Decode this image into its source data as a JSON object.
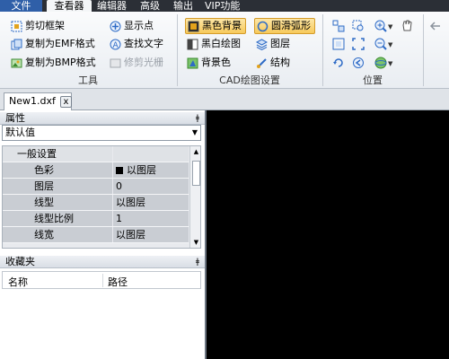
{
  "menu": {
    "file": "文件",
    "tabs": [
      "查看器",
      "编辑器",
      "高级",
      "输出",
      "VIP功能"
    ]
  },
  "ribbon": {
    "tools": {
      "label": "工具",
      "buttons": [
        "剪切框架",
        "复制为EMF格式",
        "复制为BMP格式",
        "显示点",
        "查找文字",
        "修剪光栅"
      ]
    },
    "cad": {
      "label": "CAD绘图设置",
      "buttons": [
        "黑色背景",
        "黑白绘图",
        "背景色",
        "圆滑弧形",
        "图层",
        "结构"
      ]
    },
    "position": {
      "label": "位置"
    }
  },
  "doc_tab": {
    "name": "New1.dxf",
    "close": "x"
  },
  "properties": {
    "title": "属性",
    "pin": "ǂ",
    "dropdown_value": "默认值",
    "group": "一般设置",
    "rows": [
      {
        "label": "色彩",
        "value": "以图层"
      },
      {
        "label": "图层",
        "value": "0"
      },
      {
        "label": "线型",
        "value": "以图层"
      },
      {
        "label": "线型比例",
        "value": "1"
      },
      {
        "label": "线宽",
        "value": "以图层"
      }
    ]
  },
  "favorites": {
    "title": "收藏夹",
    "pin": "ǂ",
    "columns": [
      "名称",
      "路径"
    ]
  },
  "colors": {
    "menubar": "#2b2f36",
    "file_tab": "#2f5fa8",
    "canvas": "#000000",
    "selected": "#f7c95b"
  }
}
